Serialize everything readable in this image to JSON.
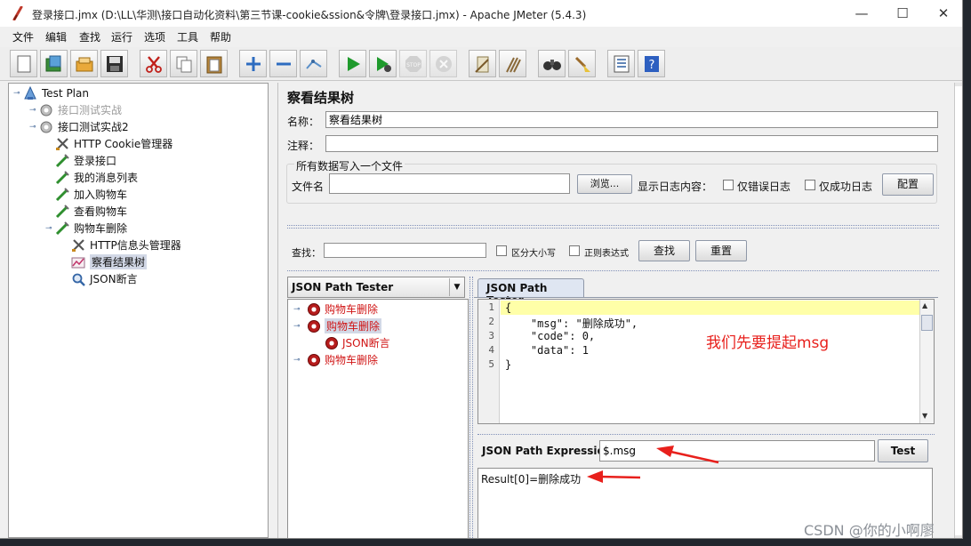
{
  "window": {
    "title": "登录接口.jmx (D:\\LL\\华测\\接口自动化资料\\第三节课-cookie&ssion&令牌\\登录接口.jmx) - Apache JMeter (5.4.3)",
    "minimize": "—",
    "maximize": "☐",
    "close": "✕"
  },
  "menu": [
    "文件",
    "编辑",
    "查找",
    "运行",
    "选项",
    "工具",
    "帮助"
  ],
  "toolbar": [
    {
      "icon": "new-icon"
    },
    {
      "icon": "templates-icon"
    },
    {
      "icon": "open-icon"
    },
    {
      "icon": "save-icon"
    },
    {
      "icon": "cut-icon"
    },
    {
      "icon": "copy-icon"
    },
    {
      "icon": "paste-icon"
    },
    {
      "icon": "expand-icon"
    },
    {
      "icon": "collapse-icon"
    },
    {
      "icon": "toggle-icon"
    },
    {
      "icon": "start-icon"
    },
    {
      "icon": "start-no-pause-icon"
    },
    {
      "icon": "stop-icon"
    },
    {
      "icon": "shutdown-icon"
    },
    {
      "icon": "clear-icon"
    },
    {
      "icon": "clear-all-icon"
    },
    {
      "icon": "search-icon"
    },
    {
      "icon": "reset-search-icon"
    },
    {
      "icon": "function-helper-icon"
    },
    {
      "icon": "help-icon"
    }
  ],
  "tree": [
    {
      "label": "Test Plan",
      "indent": 0,
      "state": "normal",
      "icon": "testplan-icon"
    },
    {
      "label": "接口测试实战",
      "indent": 1,
      "state": "disabled",
      "icon": "threadgroup-icon"
    },
    {
      "label": "接口测试实战2",
      "indent": 1,
      "state": "normal",
      "icon": "threadgroup-icon"
    },
    {
      "label": "HTTP Cookie管理器",
      "indent": 2,
      "state": "normal",
      "icon": "config-icon"
    },
    {
      "label": "登录接口",
      "indent": 2,
      "state": "normal",
      "icon": "sampler-icon"
    },
    {
      "label": "我的消息列表",
      "indent": 2,
      "state": "normal",
      "icon": "sampler-icon"
    },
    {
      "label": "加入购物车",
      "indent": 2,
      "state": "normal",
      "icon": "sampler-icon"
    },
    {
      "label": "查看购物车",
      "indent": 2,
      "state": "normal",
      "icon": "sampler-icon"
    },
    {
      "label": "购物车删除",
      "indent": 2,
      "state": "normal",
      "icon": "sampler-icon"
    },
    {
      "label": "HTTP信息头管理器",
      "indent": 3,
      "state": "normal",
      "icon": "config-icon"
    },
    {
      "label": "察看结果树",
      "indent": 3,
      "state": "selected",
      "icon": "listener-icon"
    },
    {
      "label": "JSON断言",
      "indent": 3,
      "state": "normal",
      "icon": "assertion-icon"
    }
  ],
  "panel": {
    "heading": "察看结果树",
    "name_label": "名称：",
    "name_value": "察看结果树",
    "comment_label": "注释：",
    "comment_value": "",
    "file_group_title": "所有数据写入一个文件",
    "filename_label": "文件名",
    "filename_value": "",
    "browse_button": "浏览...",
    "log_display_label": "显示日志内容：",
    "errors_only_label": "仅错误日志",
    "success_only_label": "仅成功日志",
    "configure_button": "配置",
    "search_label": "查找：",
    "search_value": "",
    "case_sensitive_label": "区分大小写",
    "regex_label": "正则表达式",
    "find_button": "查找",
    "reset_button": "重置",
    "renderer_selected": "JSON Path Tester"
  },
  "results": [
    {
      "label": "购物车删除",
      "indent": 0,
      "selected": false
    },
    {
      "label": "购物车删除",
      "indent": 0,
      "selected": true
    },
    {
      "label": "JSON断言",
      "indent": 1,
      "selected": false
    },
    {
      "label": "购物车删除",
      "indent": 0,
      "selected": false
    }
  ],
  "tester": {
    "tab_label": "JSON Path Tester",
    "lines": [
      "{",
      "    \"msg\": \"删除成功\",",
      "    \"code\": 0,",
      "    \"data\": 1",
      "}"
    ],
    "line_numbers": [
      "1",
      "2",
      "3",
      "4",
      "5"
    ],
    "annotation": "我们先要提起msg",
    "expression_label": "JSON Path Expression",
    "expression_value": "$.msg",
    "test_button": "Test",
    "result": "Result[0]=删除成功"
  },
  "watermark": "CSDN @你的小啊廖",
  "colors": {
    "annotation_red": "#e8201c",
    "result_node_red": "#d01414",
    "highlight_line": "#ffffa8"
  }
}
